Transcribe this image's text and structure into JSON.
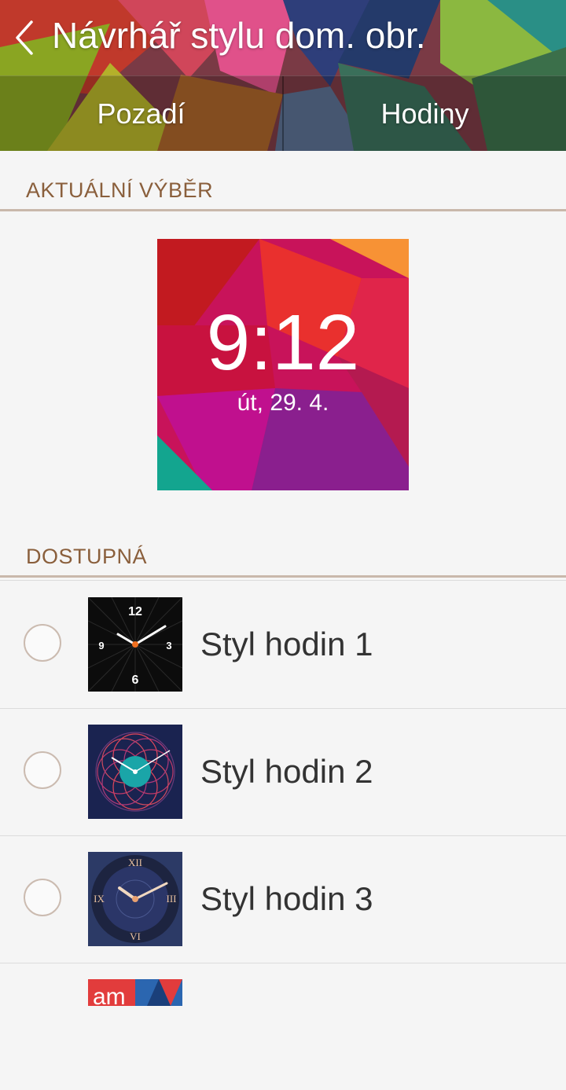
{
  "header": {
    "title": "Návrhář stylu dom. obr.",
    "back_icon": "chevron-left-icon"
  },
  "tabs": [
    {
      "label": "Pozadí"
    },
    {
      "label": "Hodiny"
    }
  ],
  "current_section": {
    "title": "AKTUÁLNÍ VÝBĚR",
    "preview_time": "9:12",
    "preview_date": "út, 29. 4."
  },
  "available_section": {
    "title": "DOSTUPNÁ",
    "items": [
      {
        "label": "Styl hodin 1",
        "selected": false,
        "dial_numbers": [
          "12",
          "3",
          "6",
          "9"
        ]
      },
      {
        "label": "Styl hodin 2",
        "selected": false
      },
      {
        "label": "Styl hodin 3",
        "selected": false,
        "dial_numbers": [
          "XII",
          "III",
          "VI",
          "IX"
        ]
      },
      {
        "thumb_text": "am"
      }
    ]
  }
}
